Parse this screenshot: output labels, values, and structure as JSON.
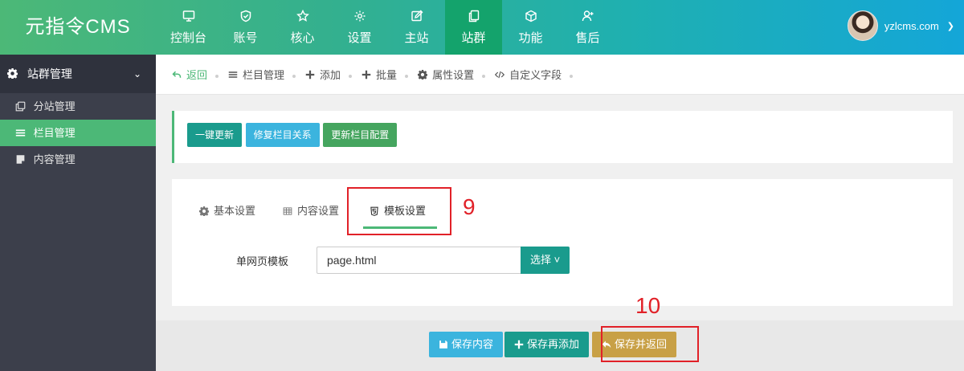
{
  "header": {
    "logo": "元指令CMS",
    "nav": [
      {
        "label": "控制台",
        "icon": "monitor-icon"
      },
      {
        "label": "账号",
        "icon": "shield-icon"
      },
      {
        "label": "核心",
        "icon": "star-icon"
      },
      {
        "label": "设置",
        "icon": "gear-icon"
      },
      {
        "label": "主站",
        "icon": "edit-icon"
      },
      {
        "label": "站群",
        "icon": "copy-icon",
        "active": true
      },
      {
        "label": "功能",
        "icon": "cube-icon"
      },
      {
        "label": "售后",
        "icon": "user-plus-icon"
      }
    ],
    "user": {
      "name": "yzlcms.com",
      "caret": "❯"
    }
  },
  "sidebar": {
    "heading": "站群管理",
    "items": [
      {
        "label": "分站管理",
        "icon": "copy-icon"
      },
      {
        "label": "栏目管理",
        "icon": "list-icon",
        "active": true
      },
      {
        "label": "内容管理",
        "icon": "file-icon"
      }
    ]
  },
  "breadcrumb": [
    {
      "label": "返回",
      "icon": "back-icon"
    },
    {
      "label": "栏目管理",
      "icon": "list-icon"
    },
    {
      "label": "添加",
      "icon": "plus-icon"
    },
    {
      "label": "批量",
      "icon": "plus-icon"
    },
    {
      "label": "属性设置",
      "icon": "gear-icon"
    },
    {
      "label": "自定义字段",
      "icon": "code-icon"
    }
  ],
  "actions": {
    "one_click_update": "一键更新",
    "repair_relation": "修复栏目关系",
    "update_config": "更新栏目配置"
  },
  "tabs": {
    "basic": "基本设置",
    "content": "内容设置",
    "template": "模板设置"
  },
  "form": {
    "label": "单网页模板",
    "value": "page.html",
    "select_label": "选择"
  },
  "footer": {
    "save_content": "保存内容",
    "save_add": "保存再添加",
    "save_return": "保存并返回"
  },
  "annotations": {
    "step9": "9",
    "step10": "10"
  },
  "colors": {
    "accent_green": "#4cb877",
    "teal": "#1a9b8d",
    "blue": "#3bb4de",
    "gold": "#c8a046",
    "annotation_red": "#e12128"
  }
}
